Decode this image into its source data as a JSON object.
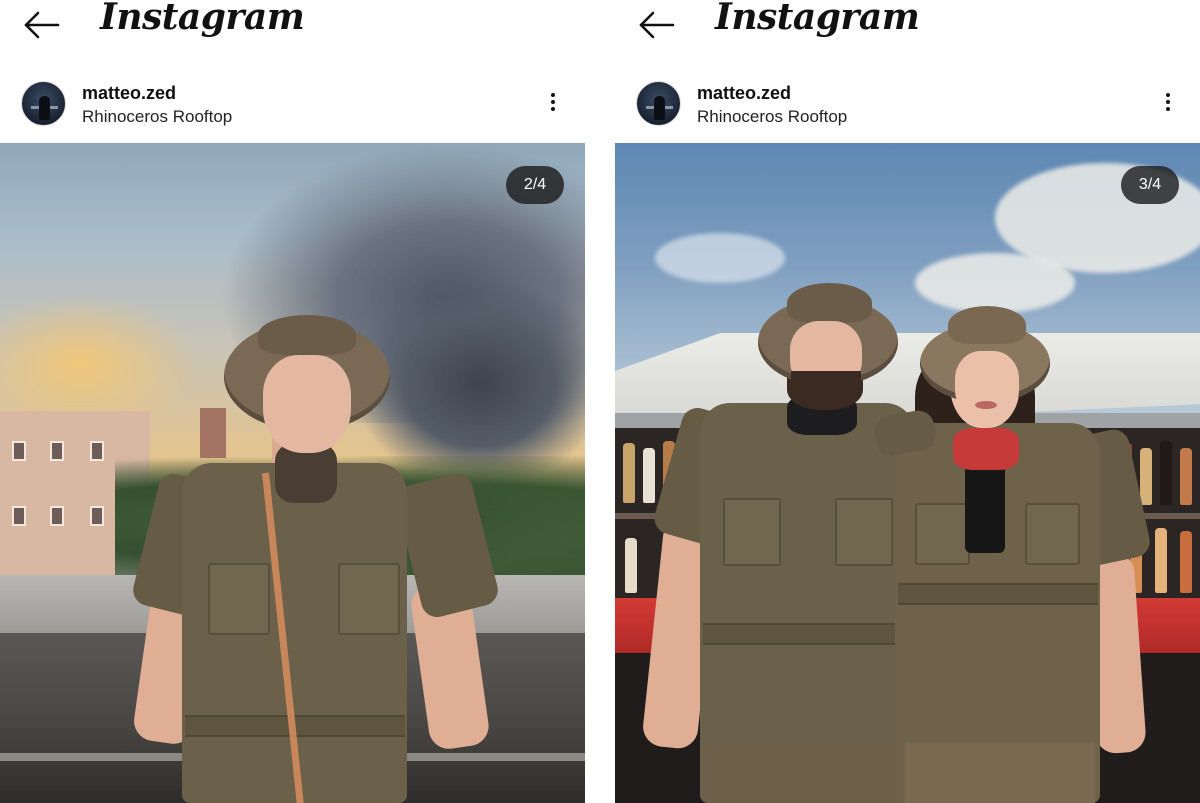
{
  "posts": [
    {
      "app_title": "Instagram",
      "username": "matteo.zed",
      "location": "Rhinoceros Rooftop",
      "counter": "2/4"
    },
    {
      "app_title": "Instagram",
      "username": "matteo.zed",
      "location": "Rhinoceros Rooftop",
      "counter": "3/4"
    }
  ],
  "icons": {
    "back": "arrow-left-icon",
    "more": "three-dots-vertical-icon"
  },
  "colors": {
    "counter_bg": "#1e1e1e",
    "text": "#111111",
    "uniform": "#6b6049",
    "bar_red": "#d33a35"
  }
}
